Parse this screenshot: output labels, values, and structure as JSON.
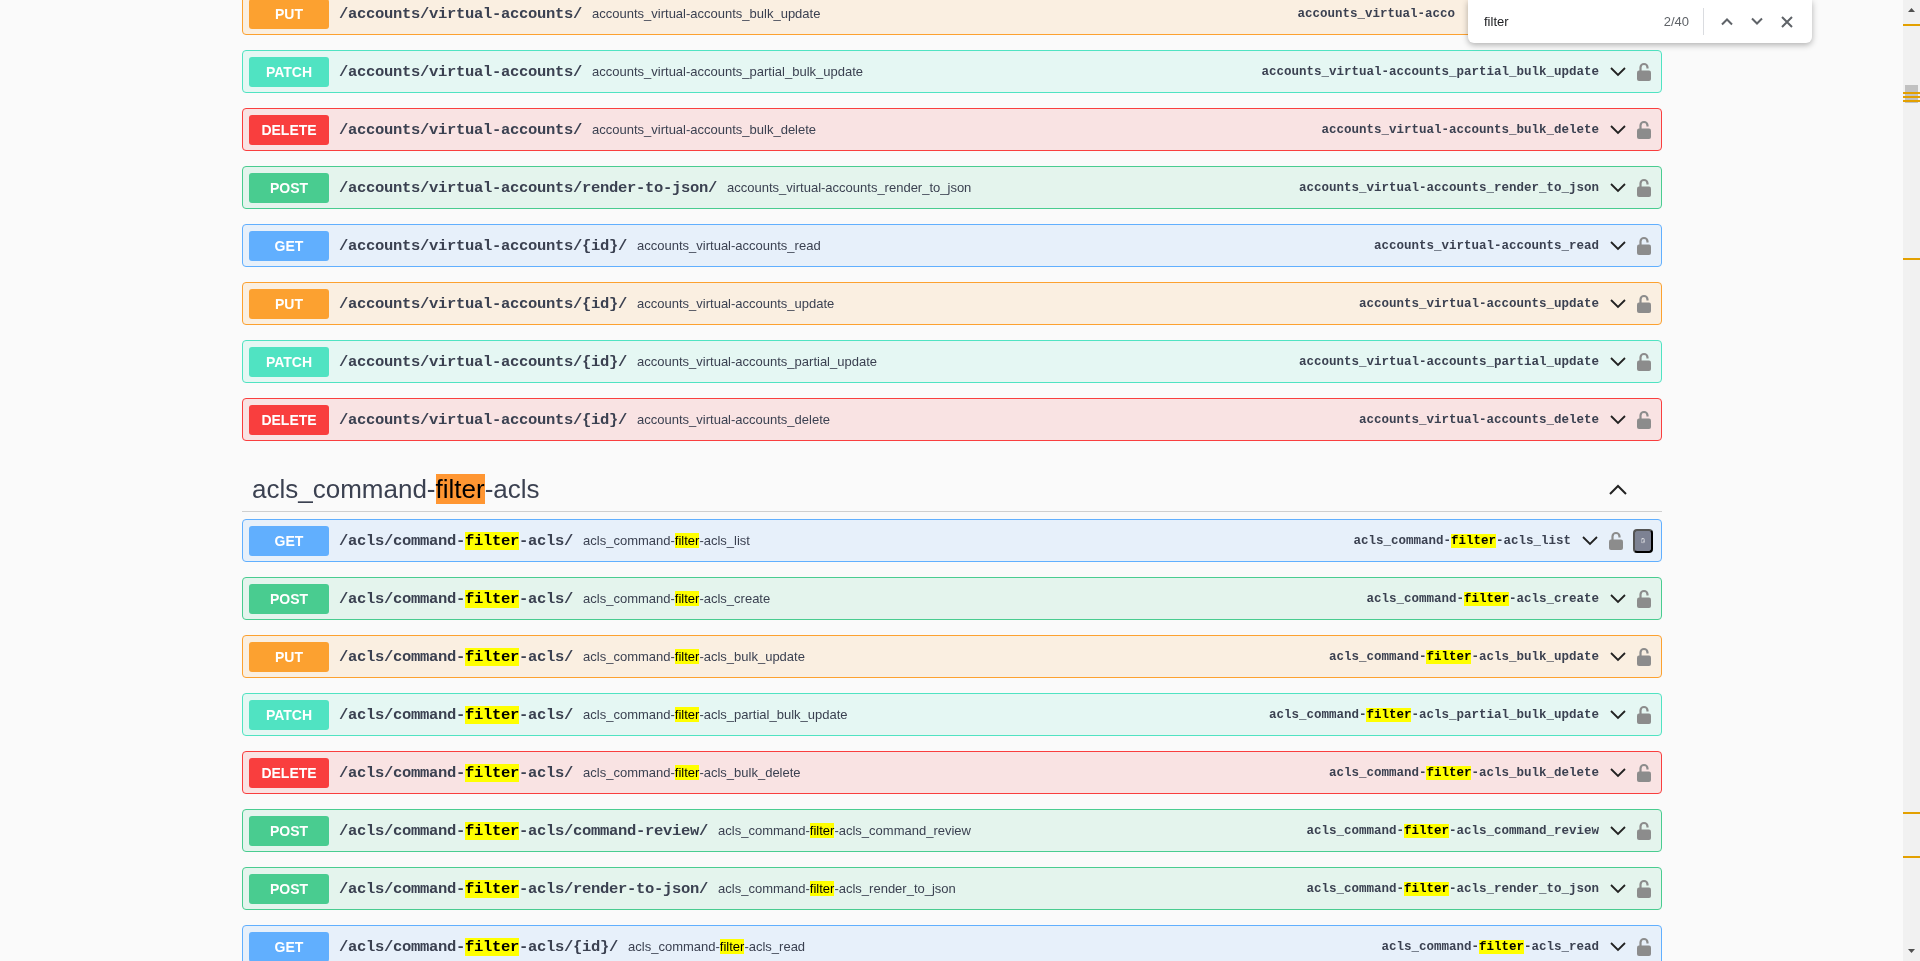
{
  "find_bar": {
    "query": "filter",
    "count": "2/40"
  },
  "sections": [
    {
      "rows": [
        {
          "method": "PUT",
          "path": [
            {
              "text": "/accounts/virtual-accounts/"
            }
          ],
          "summary": [
            {
              "text": "accounts_virtual-accounts_bulk_update"
            }
          ],
          "operation_id": [
            {
              "text": "accounts_virtual-acco"
            }
          ],
          "copy_button": false
        },
        {
          "method": "PATCH",
          "path": [
            {
              "text": "/accounts/virtual-accounts/"
            }
          ],
          "summary": [
            {
              "text": "accounts_virtual-accounts_partial_bulk_update"
            }
          ],
          "operation_id": [
            {
              "text": "accounts_virtual-accounts_partial_bulk_update"
            }
          ],
          "expanded": false,
          "copy_button": false
        },
        {
          "method": "DELETE",
          "path": [
            {
              "text": "/accounts/virtual-accounts/"
            }
          ],
          "summary": [
            {
              "text": "accounts_virtual-accounts_bulk_delete"
            }
          ],
          "operation_id": [
            {
              "text": "accounts_virtual-accounts_bulk_delete"
            }
          ],
          "expanded": false,
          "copy_button": false
        },
        {
          "method": "POST",
          "path": [
            {
              "text": "/accounts/virtual-accounts/render-to-json/"
            }
          ],
          "summary": [
            {
              "text": "accounts_virtual-accounts_render_to_json"
            }
          ],
          "operation_id": [
            {
              "text": "accounts_virtual-accounts_render_to_json"
            }
          ],
          "expanded": false,
          "copy_button": false
        },
        {
          "method": "GET",
          "path": [
            {
              "text": "/accounts/virtual-accounts/{id}/"
            }
          ],
          "summary": [
            {
              "text": "accounts_virtual-accounts_read"
            }
          ],
          "operation_id": [
            {
              "text": "accounts_virtual-accounts_read"
            }
          ],
          "expanded": false,
          "copy_button": false
        },
        {
          "method": "PUT",
          "path": [
            {
              "text": "/accounts/virtual-accounts/{id}/"
            }
          ],
          "summary": [
            {
              "text": "accounts_virtual-accounts_update"
            }
          ],
          "operation_id": [
            {
              "text": "accounts_virtual-accounts_update"
            }
          ],
          "expanded": false,
          "copy_button": false
        },
        {
          "method": "PATCH",
          "path": [
            {
              "text": "/accounts/virtual-accounts/{id}/"
            }
          ],
          "summary": [
            {
              "text": "accounts_virtual-accounts_partial_update"
            }
          ],
          "operation_id": [
            {
              "text": "accounts_virtual-accounts_partial_update"
            }
          ],
          "expanded": false,
          "copy_button": false
        },
        {
          "method": "DELETE",
          "path": [
            {
              "text": "/accounts/virtual-accounts/{id}/"
            }
          ],
          "summary": [
            {
              "text": "accounts_virtual-accounts_delete"
            }
          ],
          "operation_id": [
            {
              "text": "accounts_virtual-accounts_delete"
            }
          ],
          "expanded": false,
          "copy_button": false
        }
      ]
    },
    {
      "title": [
        {
          "text": "acls_command-",
          "highlighted": false
        },
        {
          "text": "filter",
          "highlighted": true,
          "current": true
        },
        {
          "text": "-acls",
          "highlighted": false
        }
      ],
      "expanded": true,
      "rows": [
        {
          "method": "GET",
          "path": [
            {
              "text": "/acls/command-",
              "highlighted": false
            },
            {
              "text": "filter",
              "highlighted": true,
              "current": false
            },
            {
              "text": "-acls/",
              "highlighted": false
            }
          ],
          "summary": [
            {
              "text": "acls_command-",
              "highlighted": false
            },
            {
              "text": "filter",
              "highlighted": true,
              "current": false
            },
            {
              "text": "-acls_list",
              "highlighted": false
            }
          ],
          "operation_id": [
            {
              "text": "acls_command-",
              "highlighted": false
            },
            {
              "text": "filter",
              "highlighted": true,
              "current": false
            },
            {
              "text": "-acls_list",
              "highlighted": false
            }
          ],
          "expanded": false,
          "copy_button": true
        },
        {
          "method": "POST",
          "path": [
            {
              "text": "/acls/command-",
              "highlighted": false
            },
            {
              "text": "filter",
              "highlighted": true,
              "current": false
            },
            {
              "text": "-acls/",
              "highlighted": false
            }
          ],
          "summary": [
            {
              "text": "acls_command-",
              "highlighted": false
            },
            {
              "text": "filter",
              "highlighted": true,
              "current": false
            },
            {
              "text": "-acls_create",
              "highlighted": false
            }
          ],
          "operation_id": [
            {
              "text": "acls_command-",
              "highlighted": false
            },
            {
              "text": "filter",
              "highlighted": true,
              "current": false
            },
            {
              "text": "-acls_create",
              "highlighted": false
            }
          ],
          "expanded": false,
          "copy_button": false
        },
        {
          "method": "PUT",
          "path": [
            {
              "text": "/acls/command-",
              "highlighted": false
            },
            {
              "text": "filter",
              "highlighted": true,
              "current": false
            },
            {
              "text": "-acls/",
              "highlighted": false
            }
          ],
          "summary": [
            {
              "text": "acls_command-",
              "highlighted": false
            },
            {
              "text": "filter",
              "highlighted": true,
              "current": false
            },
            {
              "text": "-acls_bulk_update",
              "highlighted": false
            }
          ],
          "operation_id": [
            {
              "text": "acls_command-",
              "highlighted": false
            },
            {
              "text": "filter",
              "highlighted": true,
              "current": false
            },
            {
              "text": "-acls_bulk_update",
              "highlighted": false
            }
          ],
          "expanded": false,
          "copy_button": false
        },
        {
          "method": "PATCH",
          "path": [
            {
              "text": "/acls/command-",
              "highlighted": false
            },
            {
              "text": "filter",
              "highlighted": true,
              "current": false
            },
            {
              "text": "-acls/",
              "highlighted": false
            }
          ],
          "summary": [
            {
              "text": "acls_command-",
              "highlighted": false
            },
            {
              "text": "filter",
              "highlighted": true,
              "current": false
            },
            {
              "text": "-acls_partial_bulk_update",
              "highlighted": false
            }
          ],
          "operation_id": [
            {
              "text": "acls_command-",
              "highlighted": false
            },
            {
              "text": "filter",
              "highlighted": true,
              "current": false
            },
            {
              "text": "-acls_partial_bulk_update",
              "highlighted": false
            }
          ],
          "expanded": false,
          "copy_button": false
        },
        {
          "method": "DELETE",
          "path": [
            {
              "text": "/acls/command-",
              "highlighted": false
            },
            {
              "text": "filter",
              "highlighted": true,
              "current": false
            },
            {
              "text": "-acls/",
              "highlighted": false
            }
          ],
          "summary": [
            {
              "text": "acls_command-",
              "highlighted": false
            },
            {
              "text": "filter",
              "highlighted": true,
              "current": false
            },
            {
              "text": "-acls_bulk_delete",
              "highlighted": false
            }
          ],
          "operation_id": [
            {
              "text": "acls_command-",
              "highlighted": false
            },
            {
              "text": "filter",
              "highlighted": true,
              "current": false
            },
            {
              "text": "-acls_bulk_delete",
              "highlighted": false
            }
          ],
          "expanded": false,
          "copy_button": false
        },
        {
          "method": "POST",
          "path": [
            {
              "text": "/acls/command-",
              "highlighted": false
            },
            {
              "text": "filter",
              "highlighted": true,
              "current": false
            },
            {
              "text": "-acls/command-review/",
              "highlighted": false
            }
          ],
          "summary": [
            {
              "text": "acls_command-",
              "highlighted": false
            },
            {
              "text": "filter",
              "highlighted": true,
              "current": false
            },
            {
              "text": "-acls_command_review",
              "highlighted": false
            }
          ],
          "operation_id": [
            {
              "text": "acls_command-",
              "highlighted": false
            },
            {
              "text": "filter",
              "highlighted": true,
              "current": false
            },
            {
              "text": "-acls_command_review",
              "highlighted": false
            }
          ],
          "expanded": false,
          "copy_button": false
        },
        {
          "method": "POST",
          "path": [
            {
              "text": "/acls/command-",
              "highlighted": false
            },
            {
              "text": "filter",
              "highlighted": true,
              "current": false
            },
            {
              "text": "-acls/render-to-json/",
              "highlighted": false
            }
          ],
          "summary": [
            {
              "text": "acls_command-",
              "highlighted": false
            },
            {
              "text": "filter",
              "highlighted": true,
              "current": false
            },
            {
              "text": "-acls_render_to_json",
              "highlighted": false
            }
          ],
          "operation_id": [
            {
              "text": "acls_command-",
              "highlighted": false
            },
            {
              "text": "filter",
              "highlighted": true,
              "current": false
            },
            {
              "text": "-acls_render_to_json",
              "highlighted": false
            }
          ],
          "expanded": false,
          "copy_button": false
        },
        {
          "method": "GET",
          "path": [
            {
              "text": "/acls/command-",
              "highlighted": false
            },
            {
              "text": "filter",
              "highlighted": true,
              "current": false
            },
            {
              "text": "-acls/{id}/",
              "highlighted": false
            }
          ],
          "summary": [
            {
              "text": "acls_command-",
              "highlighted": false
            },
            {
              "text": "filter",
              "highlighted": true,
              "current": false
            },
            {
              "text": "-acls_read",
              "highlighted": false
            }
          ],
          "operation_id": [
            {
              "text": "acls_command-",
              "highlighted": false
            },
            {
              "text": "filter",
              "highlighted": true,
              "current": false
            },
            {
              "text": "-acls_read",
              "highlighted": false
            }
          ],
          "expanded": false,
          "copy_button": false
        }
      ]
    }
  ]
}
